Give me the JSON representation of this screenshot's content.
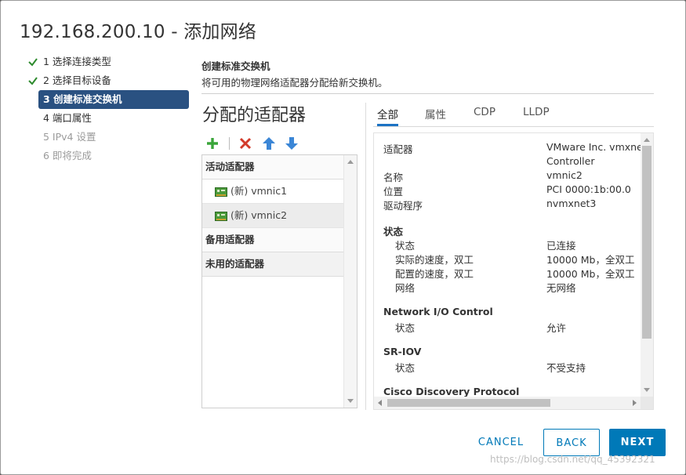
{
  "dialog": {
    "title": "192.168.200.10 - 添加网络"
  },
  "steps": [
    {
      "label": "1 选择连接类型",
      "state": "done"
    },
    {
      "label": "2 选择目标设备",
      "state": "done"
    },
    {
      "label": "3 创建标准交换机",
      "state": "active"
    },
    {
      "label": "4 端口属性",
      "state": "pending"
    },
    {
      "label": "5 IPv4 设置",
      "state": "disabled"
    },
    {
      "label": "6 即将完成",
      "state": "disabled"
    }
  ],
  "section": {
    "heading": "创建标准交换机",
    "description": "将可用的物理网络适配器分配给新交换机。"
  },
  "assign": {
    "title": "分配的适配器",
    "toolbar": {
      "add_icon": "plus-icon",
      "remove_icon": "x-icon",
      "up_icon": "arrow-up-icon",
      "down_icon": "arrow-down-icon"
    },
    "groups": {
      "active": "活动适配器",
      "standby": "备用适配器",
      "unused": "未用的适配器"
    },
    "nics": [
      {
        "label": "(新) vmnic1",
        "selected": false
      },
      {
        "label": "(新) vmnic2",
        "selected": true
      }
    ]
  },
  "tabs": [
    "全部",
    "属性",
    "CDP",
    "LLDP"
  ],
  "details": {
    "adapter_label": "适配器",
    "adapter_value_1": "VMware Inc. vmxnet",
    "adapter_value_2": "Controller",
    "name_label": "名称",
    "name_value": "vmnic2",
    "location_label": "位置",
    "location_value": "PCI 0000:1b:00.0",
    "driver_label": "驱动程序",
    "driver_value": "nvmxnet3",
    "status_heading": "状态",
    "status_label": "状态",
    "status_value": "已连接",
    "actual_speed_label": "实际的速度，双工",
    "actual_speed_value": "10000 Mb，全双工",
    "config_speed_label": "配置的速度，双工",
    "config_speed_value": "10000 Mb，全双工",
    "network_label": "网络",
    "network_value": "无网络",
    "nioc_heading": "Network I/O Control",
    "nioc_status_label": "状态",
    "nioc_status_value": "允许",
    "sriov_heading": "SR-IOV",
    "sriov_status_label": "状态",
    "sriov_status_value": "不受支持",
    "cdp_heading": "Cisco Discovery Protocol"
  },
  "buttons": {
    "cancel": "CANCEL",
    "back": "BACK",
    "next": "NEXT"
  },
  "watermark": "https://blog.csdn.net/qq_45392321",
  "colors": {
    "accent": "#0079b8",
    "active_step": "#2a5181",
    "check": "#2e8b2e"
  }
}
